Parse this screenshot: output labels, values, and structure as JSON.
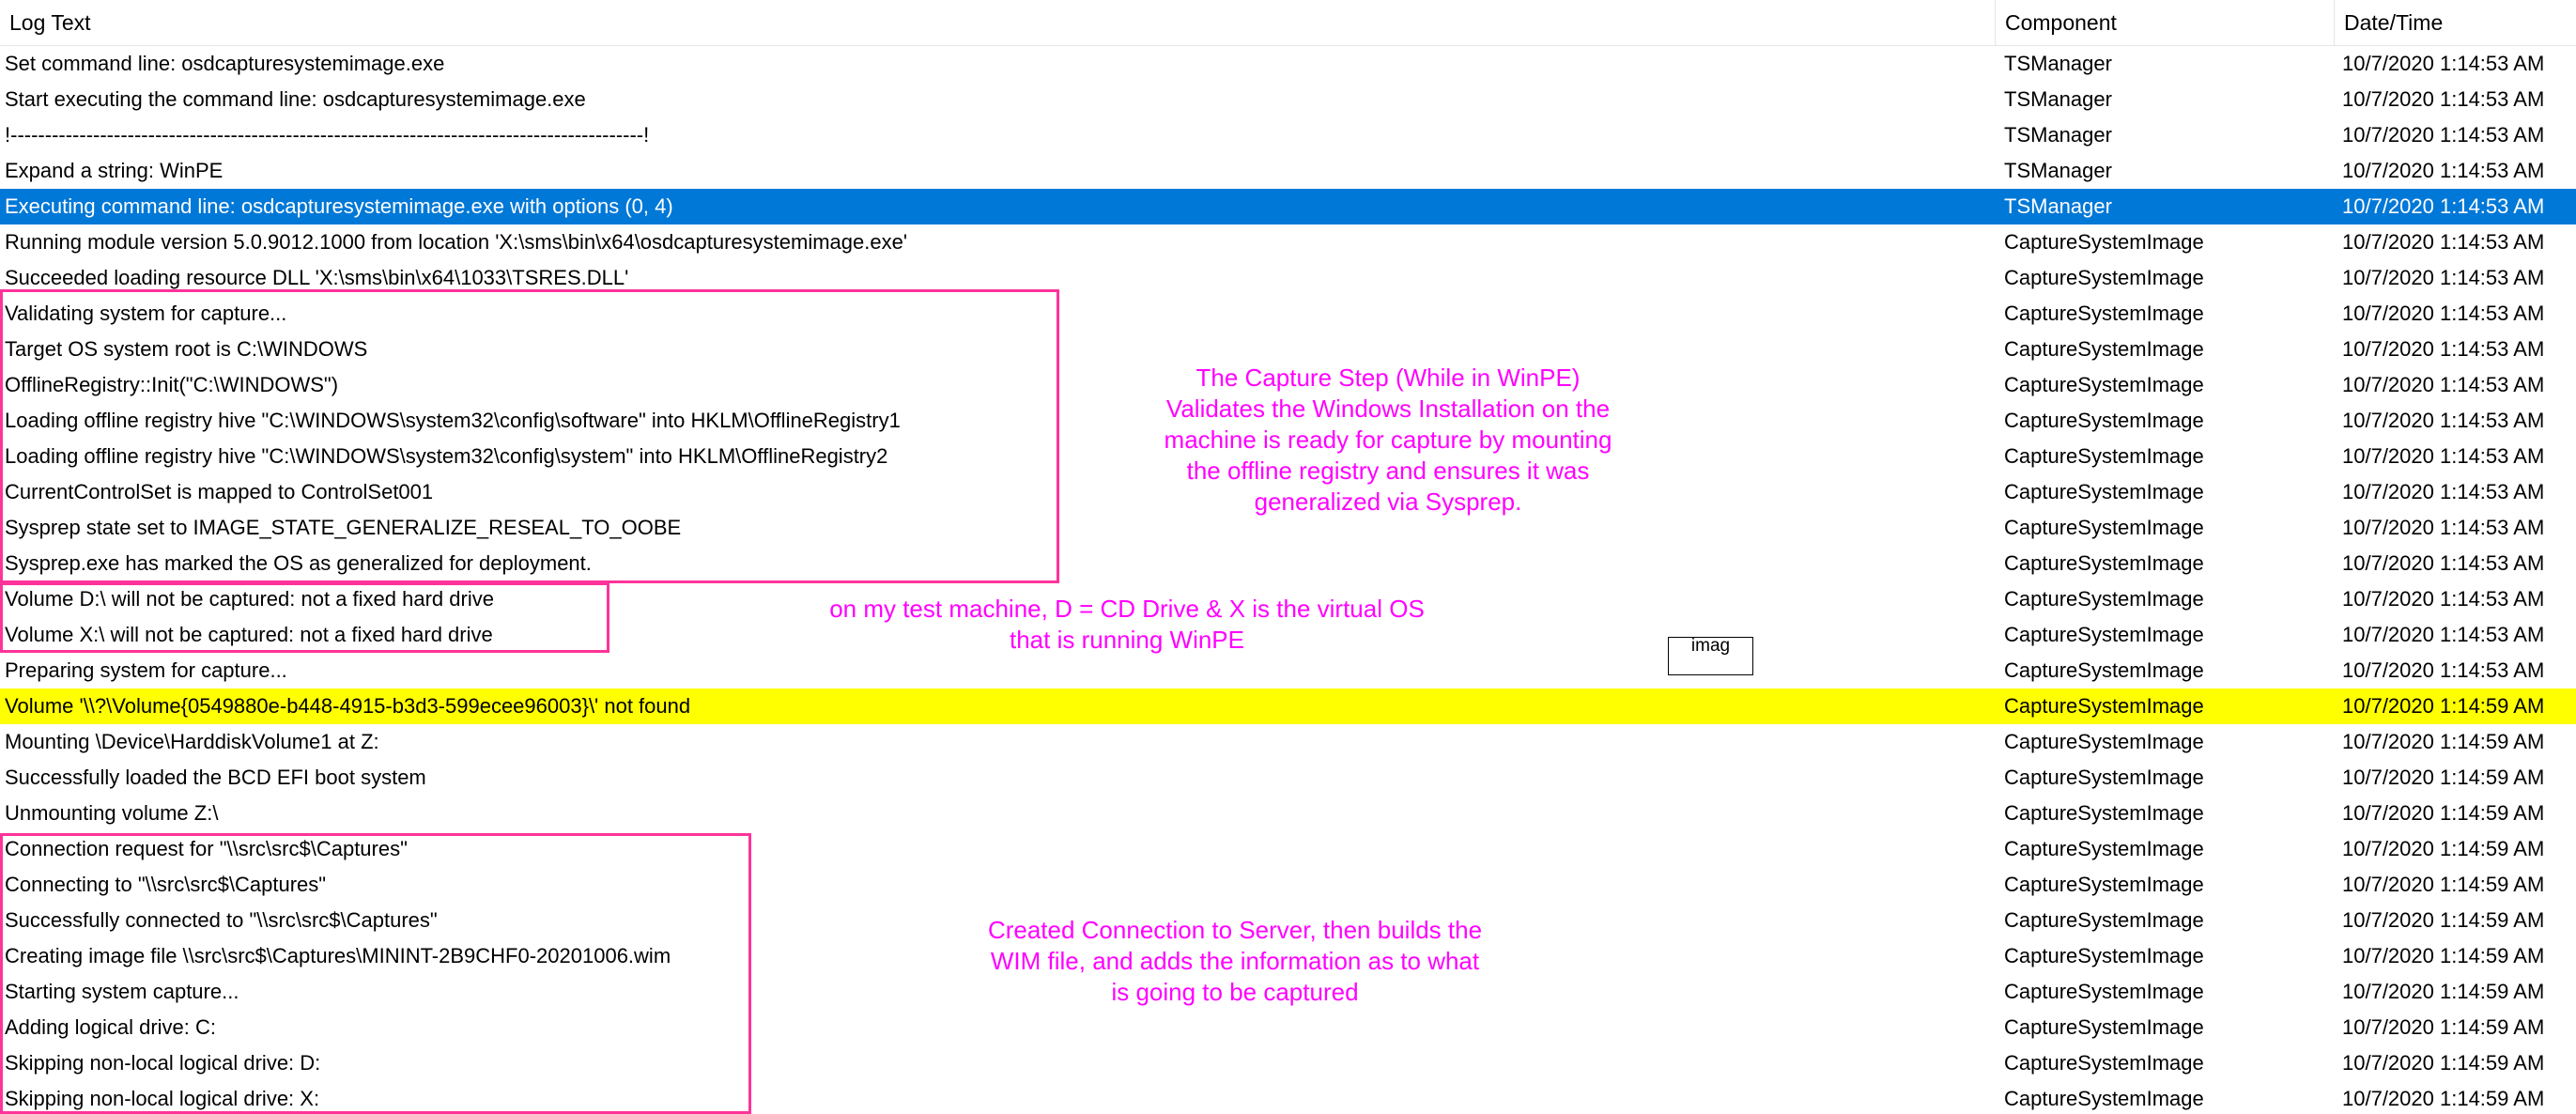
{
  "columns": {
    "log_text": "Log Text",
    "component": "Component",
    "datetime": "Date/Time"
  },
  "rows": [
    {
      "text": "Set command line: osdcapturesystemimage.exe",
      "component": "TSManager",
      "datetime": "10/7/2020 1:14:53 AM"
    },
    {
      "text": "Start executing the command line: osdcapturesystemimage.exe",
      "component": "TSManager",
      "datetime": "10/7/2020 1:14:53 AM"
    },
    {
      "text": "!--------------------------------------------------------------------------------------------!",
      "component": "TSManager",
      "datetime": "10/7/2020 1:14:53 AM"
    },
    {
      "text": "Expand a string: WinPE",
      "component": "TSManager",
      "datetime": "10/7/2020 1:14:53 AM"
    },
    {
      "text": "Executing command line: osdcapturesystemimage.exe with options (0, 4)",
      "component": "TSManager",
      "datetime": "10/7/2020 1:14:53 AM",
      "state": "selected"
    },
    {
      "text": "Running module version 5.0.9012.1000 from location 'X:\\sms\\bin\\x64\\osdcapturesystemimage.exe'",
      "component": "CaptureSystemImage",
      "datetime": "10/7/2020 1:14:53 AM"
    },
    {
      "text": "Succeeded loading resource DLL 'X:\\sms\\bin\\x64\\1033\\TSRES.DLL'",
      "component": "CaptureSystemImage",
      "datetime": "10/7/2020 1:14:53 AM"
    },
    {
      "text": "Validating system for capture...",
      "component": "CaptureSystemImage",
      "datetime": "10/7/2020 1:14:53 AM"
    },
    {
      "text": "Target OS system root is C:\\WINDOWS",
      "component": "CaptureSystemImage",
      "datetime": "10/7/2020 1:14:53 AM"
    },
    {
      "text": "OfflineRegistry::Init(\"C:\\WINDOWS\")",
      "component": "CaptureSystemImage",
      "datetime": "10/7/2020 1:14:53 AM"
    },
    {
      "text": "Loading offline registry hive \"C:\\WINDOWS\\system32\\config\\software\" into HKLM\\OfflineRegistry1",
      "component": "CaptureSystemImage",
      "datetime": "10/7/2020 1:14:53 AM"
    },
    {
      "text": "Loading offline registry hive \"C:\\WINDOWS\\system32\\config\\system\" into HKLM\\OfflineRegistry2",
      "component": "CaptureSystemImage",
      "datetime": "10/7/2020 1:14:53 AM"
    },
    {
      "text": "CurrentControlSet is mapped to ControlSet001",
      "component": "CaptureSystemImage",
      "datetime": "10/7/2020 1:14:53 AM"
    },
    {
      "text": "Sysprep state set to IMAGE_STATE_GENERALIZE_RESEAL_TO_OOBE",
      "component": "CaptureSystemImage",
      "datetime": "10/7/2020 1:14:53 AM"
    },
    {
      "text": "Sysprep.exe has marked the OS as generalized for deployment.",
      "component": "CaptureSystemImage",
      "datetime": "10/7/2020 1:14:53 AM"
    },
    {
      "text": "Volume D:\\ will not be captured: not a fixed hard drive",
      "component": "CaptureSystemImage",
      "datetime": "10/7/2020 1:14:53 AM"
    },
    {
      "text": "Volume X:\\ will not be captured: not a fixed hard drive",
      "component": "CaptureSystemImage",
      "datetime": "10/7/2020 1:14:53 AM"
    },
    {
      "text": "Preparing system for capture...",
      "component": "CaptureSystemImage",
      "datetime": "10/7/2020 1:14:53 AM"
    },
    {
      "text": "Volume '\\\\?\\Volume{0549880e-b448-4915-b3d3-599ecee96003}\\' not found",
      "component": "CaptureSystemImage",
      "datetime": "10/7/2020 1:14:59 AM",
      "state": "warning"
    },
    {
      "text": "Mounting \\Device\\HarddiskVolume1 at Z:",
      "component": "CaptureSystemImage",
      "datetime": "10/7/2020 1:14:59 AM"
    },
    {
      "text": "Successfully loaded the BCD EFI boot system",
      "component": "CaptureSystemImage",
      "datetime": "10/7/2020 1:14:59 AM"
    },
    {
      "text": "Unmounting volume Z:\\",
      "component": "CaptureSystemImage",
      "datetime": "10/7/2020 1:14:59 AM"
    },
    {
      "text": "Connection request for \"\\\\src\\src$\\Captures\"",
      "component": "CaptureSystemImage",
      "datetime": "10/7/2020 1:14:59 AM"
    },
    {
      "text": "Connecting to \"\\\\src\\src$\\Captures\"",
      "component": "CaptureSystemImage",
      "datetime": "10/7/2020 1:14:59 AM"
    },
    {
      "text": "Successfully connected to \"\\\\src\\src$\\Captures\"",
      "component": "CaptureSystemImage",
      "datetime": "10/7/2020 1:14:59 AM"
    },
    {
      "text": "Creating image file \\\\src\\src$\\Captures\\MININT-2B9CHF0-20201006.wim",
      "component": "CaptureSystemImage",
      "datetime": "10/7/2020 1:14:59 AM"
    },
    {
      "text": "Starting system capture...",
      "component": "CaptureSystemImage",
      "datetime": "10/7/2020 1:14:59 AM"
    },
    {
      "text": "Adding logical drive: C:",
      "component": "CaptureSystemImage",
      "datetime": "10/7/2020 1:14:59 AM"
    },
    {
      "text": "Skipping non-local logical drive: D:",
      "component": "CaptureSystemImage",
      "datetime": "10/7/2020 1:14:59 AM"
    },
    {
      "text": "Skipping non-local logical drive: X:",
      "component": "CaptureSystemImage",
      "datetime": "10/7/2020 1:14:59 AM"
    }
  ],
  "annotations": {
    "validation_note": [
      "The Capture Step (While in WinPE)",
      "Validates the Windows Installation on the",
      "machine is ready for capture by mounting",
      "the offline registry and ensures it was",
      "generalized via Sysprep."
    ],
    "drive_note": [
      "on my test machine, D = CD Drive & X is the virtual OS",
      "that is running WinPE"
    ],
    "connection_note": [
      "Created Connection to Server, then builds the",
      "WIM file, and adds the information as to what",
      "is going to be captured"
    ],
    "tooltip_fragment": "imag"
  },
  "colors": {
    "selected_row": "#0078d7",
    "warning_row": "#ffff00",
    "annotation": "#ff00ff",
    "annotation_box": "#ff3399"
  }
}
